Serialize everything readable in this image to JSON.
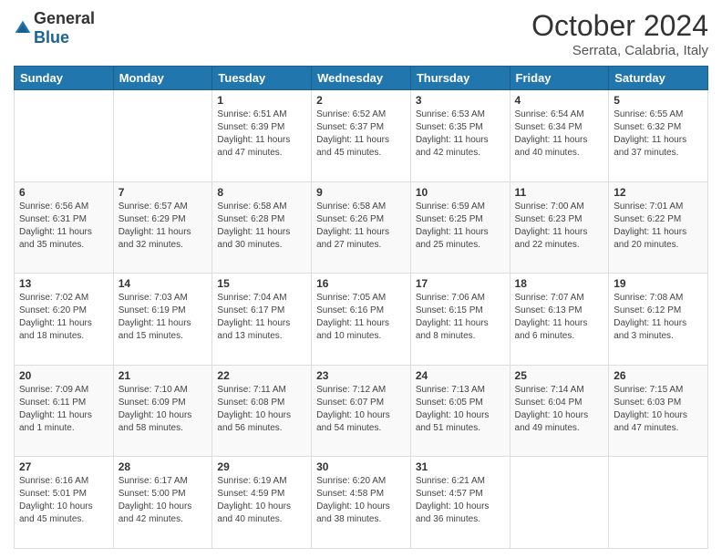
{
  "logo": {
    "general": "General",
    "blue": "Blue"
  },
  "header": {
    "month": "October 2024",
    "location": "Serrata, Calabria, Italy"
  },
  "weekdays": [
    "Sunday",
    "Monday",
    "Tuesday",
    "Wednesday",
    "Thursday",
    "Friday",
    "Saturday"
  ],
  "weeks": [
    [
      {
        "day": "",
        "info": ""
      },
      {
        "day": "",
        "info": ""
      },
      {
        "day": "1",
        "info": "Sunrise: 6:51 AM\nSunset: 6:39 PM\nDaylight: 11 hours and 47 minutes."
      },
      {
        "day": "2",
        "info": "Sunrise: 6:52 AM\nSunset: 6:37 PM\nDaylight: 11 hours and 45 minutes."
      },
      {
        "day": "3",
        "info": "Sunrise: 6:53 AM\nSunset: 6:35 PM\nDaylight: 11 hours and 42 minutes."
      },
      {
        "day": "4",
        "info": "Sunrise: 6:54 AM\nSunset: 6:34 PM\nDaylight: 11 hours and 40 minutes."
      },
      {
        "day": "5",
        "info": "Sunrise: 6:55 AM\nSunset: 6:32 PM\nDaylight: 11 hours and 37 minutes."
      }
    ],
    [
      {
        "day": "6",
        "info": "Sunrise: 6:56 AM\nSunset: 6:31 PM\nDaylight: 11 hours and 35 minutes."
      },
      {
        "day": "7",
        "info": "Sunrise: 6:57 AM\nSunset: 6:29 PM\nDaylight: 11 hours and 32 minutes."
      },
      {
        "day": "8",
        "info": "Sunrise: 6:58 AM\nSunset: 6:28 PM\nDaylight: 11 hours and 30 minutes."
      },
      {
        "day": "9",
        "info": "Sunrise: 6:58 AM\nSunset: 6:26 PM\nDaylight: 11 hours and 27 minutes."
      },
      {
        "day": "10",
        "info": "Sunrise: 6:59 AM\nSunset: 6:25 PM\nDaylight: 11 hours and 25 minutes."
      },
      {
        "day": "11",
        "info": "Sunrise: 7:00 AM\nSunset: 6:23 PM\nDaylight: 11 hours and 22 minutes."
      },
      {
        "day": "12",
        "info": "Sunrise: 7:01 AM\nSunset: 6:22 PM\nDaylight: 11 hours and 20 minutes."
      }
    ],
    [
      {
        "day": "13",
        "info": "Sunrise: 7:02 AM\nSunset: 6:20 PM\nDaylight: 11 hours and 18 minutes."
      },
      {
        "day": "14",
        "info": "Sunrise: 7:03 AM\nSunset: 6:19 PM\nDaylight: 11 hours and 15 minutes."
      },
      {
        "day": "15",
        "info": "Sunrise: 7:04 AM\nSunset: 6:17 PM\nDaylight: 11 hours and 13 minutes."
      },
      {
        "day": "16",
        "info": "Sunrise: 7:05 AM\nSunset: 6:16 PM\nDaylight: 11 hours and 10 minutes."
      },
      {
        "day": "17",
        "info": "Sunrise: 7:06 AM\nSunset: 6:15 PM\nDaylight: 11 hours and 8 minutes."
      },
      {
        "day": "18",
        "info": "Sunrise: 7:07 AM\nSunset: 6:13 PM\nDaylight: 11 hours and 6 minutes."
      },
      {
        "day": "19",
        "info": "Sunrise: 7:08 AM\nSunset: 6:12 PM\nDaylight: 11 hours and 3 minutes."
      }
    ],
    [
      {
        "day": "20",
        "info": "Sunrise: 7:09 AM\nSunset: 6:11 PM\nDaylight: 11 hours and 1 minute."
      },
      {
        "day": "21",
        "info": "Sunrise: 7:10 AM\nSunset: 6:09 PM\nDaylight: 10 hours and 58 minutes."
      },
      {
        "day": "22",
        "info": "Sunrise: 7:11 AM\nSunset: 6:08 PM\nDaylight: 10 hours and 56 minutes."
      },
      {
        "day": "23",
        "info": "Sunrise: 7:12 AM\nSunset: 6:07 PM\nDaylight: 10 hours and 54 minutes."
      },
      {
        "day": "24",
        "info": "Sunrise: 7:13 AM\nSunset: 6:05 PM\nDaylight: 10 hours and 51 minutes."
      },
      {
        "day": "25",
        "info": "Sunrise: 7:14 AM\nSunset: 6:04 PM\nDaylight: 10 hours and 49 minutes."
      },
      {
        "day": "26",
        "info": "Sunrise: 7:15 AM\nSunset: 6:03 PM\nDaylight: 10 hours and 47 minutes."
      }
    ],
    [
      {
        "day": "27",
        "info": "Sunrise: 6:16 AM\nSunset: 5:01 PM\nDaylight: 10 hours and 45 minutes."
      },
      {
        "day": "28",
        "info": "Sunrise: 6:17 AM\nSunset: 5:00 PM\nDaylight: 10 hours and 42 minutes."
      },
      {
        "day": "29",
        "info": "Sunrise: 6:19 AM\nSunset: 4:59 PM\nDaylight: 10 hours and 40 minutes."
      },
      {
        "day": "30",
        "info": "Sunrise: 6:20 AM\nSunset: 4:58 PM\nDaylight: 10 hours and 38 minutes."
      },
      {
        "day": "31",
        "info": "Sunrise: 6:21 AM\nSunset: 4:57 PM\nDaylight: 10 hours and 36 minutes."
      },
      {
        "day": "",
        "info": ""
      },
      {
        "day": "",
        "info": ""
      }
    ]
  ]
}
